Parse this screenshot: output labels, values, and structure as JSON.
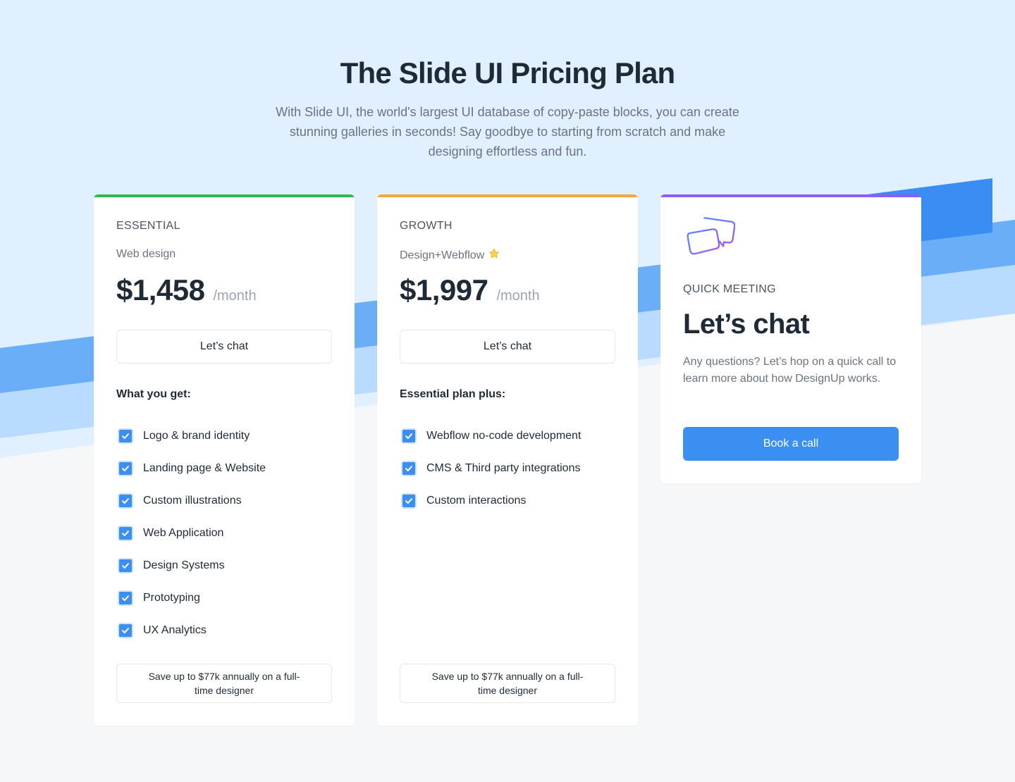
{
  "hero": {
    "title": "The Slide UI Pricing Plan",
    "subtitle": "With Slide UI, the world's largest UI database of copy-paste blocks, you can create stunning galleries in seconds! Say goodbye to starting from scratch and make designing effortless and fun."
  },
  "colors": {
    "essential_accent": "#2fb84f",
    "growth_accent": "#f2a93b",
    "meeting_accent": "#8b5cf6",
    "primary_blue": "#3b8ff0",
    "band_light": "#b9dbff",
    "band_mid": "#6aaef7",
    "band_dark": "#3a8df2",
    "hero_bg": "#e0f0fe"
  },
  "plans": [
    {
      "name": "ESSENTIAL",
      "subtitle": "Web design",
      "price": "$1,458",
      "period": "/month",
      "cta_label": "Let’s chat",
      "features_heading": "What you get:",
      "features": [
        "Logo & brand identity",
        "Landing page & Website",
        "Custom illustrations",
        "Web Application",
        "Design Systems",
        "Prototyping",
        "UX Analytics"
      ],
      "savings": "Save up to $77k annually on a full-time designer"
    },
    {
      "name": "GROWTH",
      "subtitle": "Design+Webflow",
      "subtitle_icon": "star-icon",
      "price": "$1,997",
      "period": "/month",
      "cta_label": "Let’s chat",
      "features_heading": "Essential plan plus:",
      "features": [
        "Webflow no-code development",
        "CMS & Third party integrations",
        "Custom interactions"
      ],
      "savings": "Save up to $77k annually on a full-time designer"
    }
  ],
  "meeting": {
    "icon": "chat-bubbles-icon",
    "label": "QUICK MEETING",
    "title": "Let’s chat",
    "description": "Any questions? Let’s hop on a quick call to learn more about how DesignUp works.",
    "cta_label": "Book a call"
  }
}
